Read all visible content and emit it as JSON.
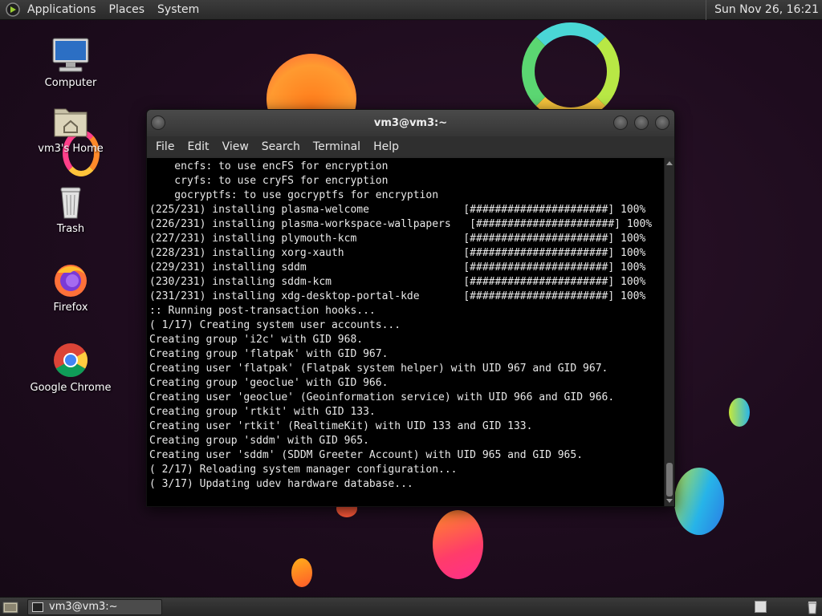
{
  "top_panel": {
    "menus": [
      "Applications",
      "Places",
      "System"
    ],
    "clock": "Sun Nov 26, 16:21"
  },
  "desktop": {
    "icons": [
      {
        "name": "computer",
        "label": "Computer",
        "icon": "computer-icon"
      },
      {
        "name": "home",
        "label": "vm3's Home",
        "icon": "home-folder-icon"
      },
      {
        "name": "trash",
        "label": "Trash",
        "icon": "trash-icon"
      },
      {
        "name": "firefox",
        "label": "Firefox",
        "icon": "firefox-icon"
      },
      {
        "name": "chrome",
        "label": "Google Chrome",
        "icon": "chrome-icon"
      }
    ]
  },
  "terminal": {
    "title": "vm3@vm3:~",
    "menus": [
      "File",
      "Edit",
      "View",
      "Search",
      "Terminal",
      "Help"
    ],
    "lines": [
      "    encfs: to use encFS for encryption",
      "    cryfs: to use cryFS for encryption",
      "    gocryptfs: to use gocryptfs for encryption",
      "(225/231) installing plasma-welcome               [######################] 100%",
      "(226/231) installing plasma-workspace-wallpapers   [######################] 100%",
      "(227/231) installing plymouth-kcm                 [######################] 100%",
      "(228/231) installing xorg-xauth                   [######################] 100%",
      "(229/231) installing sddm                         [######################] 100%",
      "(230/231) installing sddm-kcm                     [######################] 100%",
      "(231/231) installing xdg-desktop-portal-kde       [######################] 100%",
      ":: Running post-transaction hooks...",
      "( 1/17) Creating system user accounts...",
      "Creating group 'i2c' with GID 968.",
      "Creating group 'flatpak' with GID 967.",
      "Creating user 'flatpak' (Flatpak system helper) with UID 967 and GID 967.",
      "Creating group 'geoclue' with GID 966.",
      "Creating user 'geoclue' (Geoinformation service) with UID 966 and GID 966.",
      "Creating group 'rtkit' with GID 133.",
      "Creating user 'rtkit' (RealtimeKit) with UID 133 and GID 133.",
      "Creating group 'sddm' with GID 965.",
      "Creating user 'sddm' (SDDM Greeter Account) with UID 965 and GID 965.",
      "( 2/17) Reloading system manager configuration...",
      "( 3/17) Updating udev hardware database..."
    ]
  },
  "bottom_panel": {
    "task_label": "vm3@vm3:~"
  },
  "colors": {
    "desktop_bg": "#1e0c1e",
    "panel_bg": "#2f2f2f",
    "terminal_bg": "#000000",
    "terminal_fg": "#e8e8e8"
  }
}
